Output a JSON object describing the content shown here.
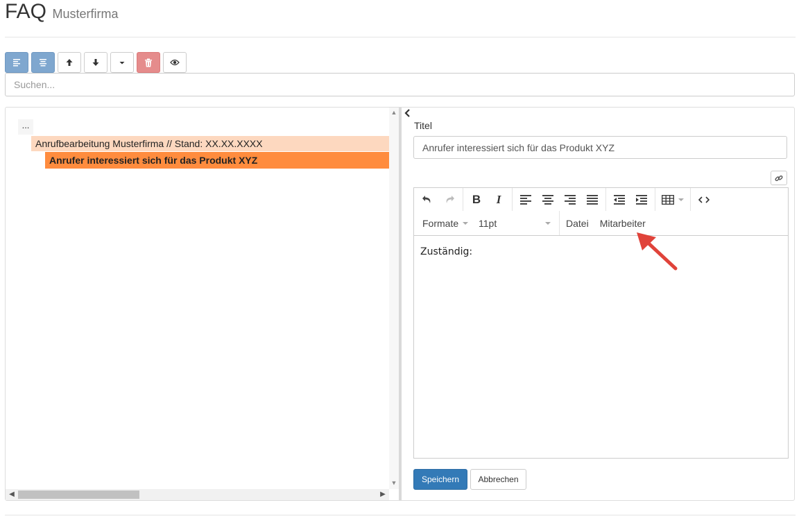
{
  "header": {
    "title": "FAQ",
    "subtitle": "Musterfirma"
  },
  "toolbar": {
    "buttons": [
      {
        "icon": "align-left-icon",
        "style": "primary-light"
      },
      {
        "icon": "align-center-icon",
        "style": "primary-light"
      },
      {
        "icon": "arrow-up-icon",
        "style": "default"
      },
      {
        "icon": "arrow-down-icon",
        "style": "default"
      },
      {
        "icon": "caret-down-icon",
        "style": "default"
      },
      {
        "icon": "trash-icon",
        "style": "danger-light"
      },
      {
        "icon": "eye-icon",
        "style": "default"
      }
    ]
  },
  "search": {
    "placeholder": "Suchen..."
  },
  "tree": {
    "root_label": "...",
    "items": [
      {
        "label": "Anrufbearbeitung Musterfirma // Stand: XX.XX.XXXX",
        "level": 1,
        "selected": false
      },
      {
        "label": "Anrufer interessiert sich für das Produkt XYZ",
        "level": 2,
        "selected": true
      }
    ]
  },
  "editor": {
    "title_label": "Titel",
    "title_value": "Anrufer interessiert sich für das Produkt XYZ",
    "menubar": {
      "formats": "Formate",
      "font_size": "11pt",
      "file": "Datei",
      "employee": "Mitarbeiter"
    },
    "content": "Zuständig:",
    "save_label": "Speichern",
    "cancel_label": "Abbrechen"
  },
  "colors": {
    "selected_item": "#ff8c3e",
    "parent_item": "#fdd8bf",
    "primary": "#337ab7",
    "annotation_arrow": "#e0433a"
  }
}
